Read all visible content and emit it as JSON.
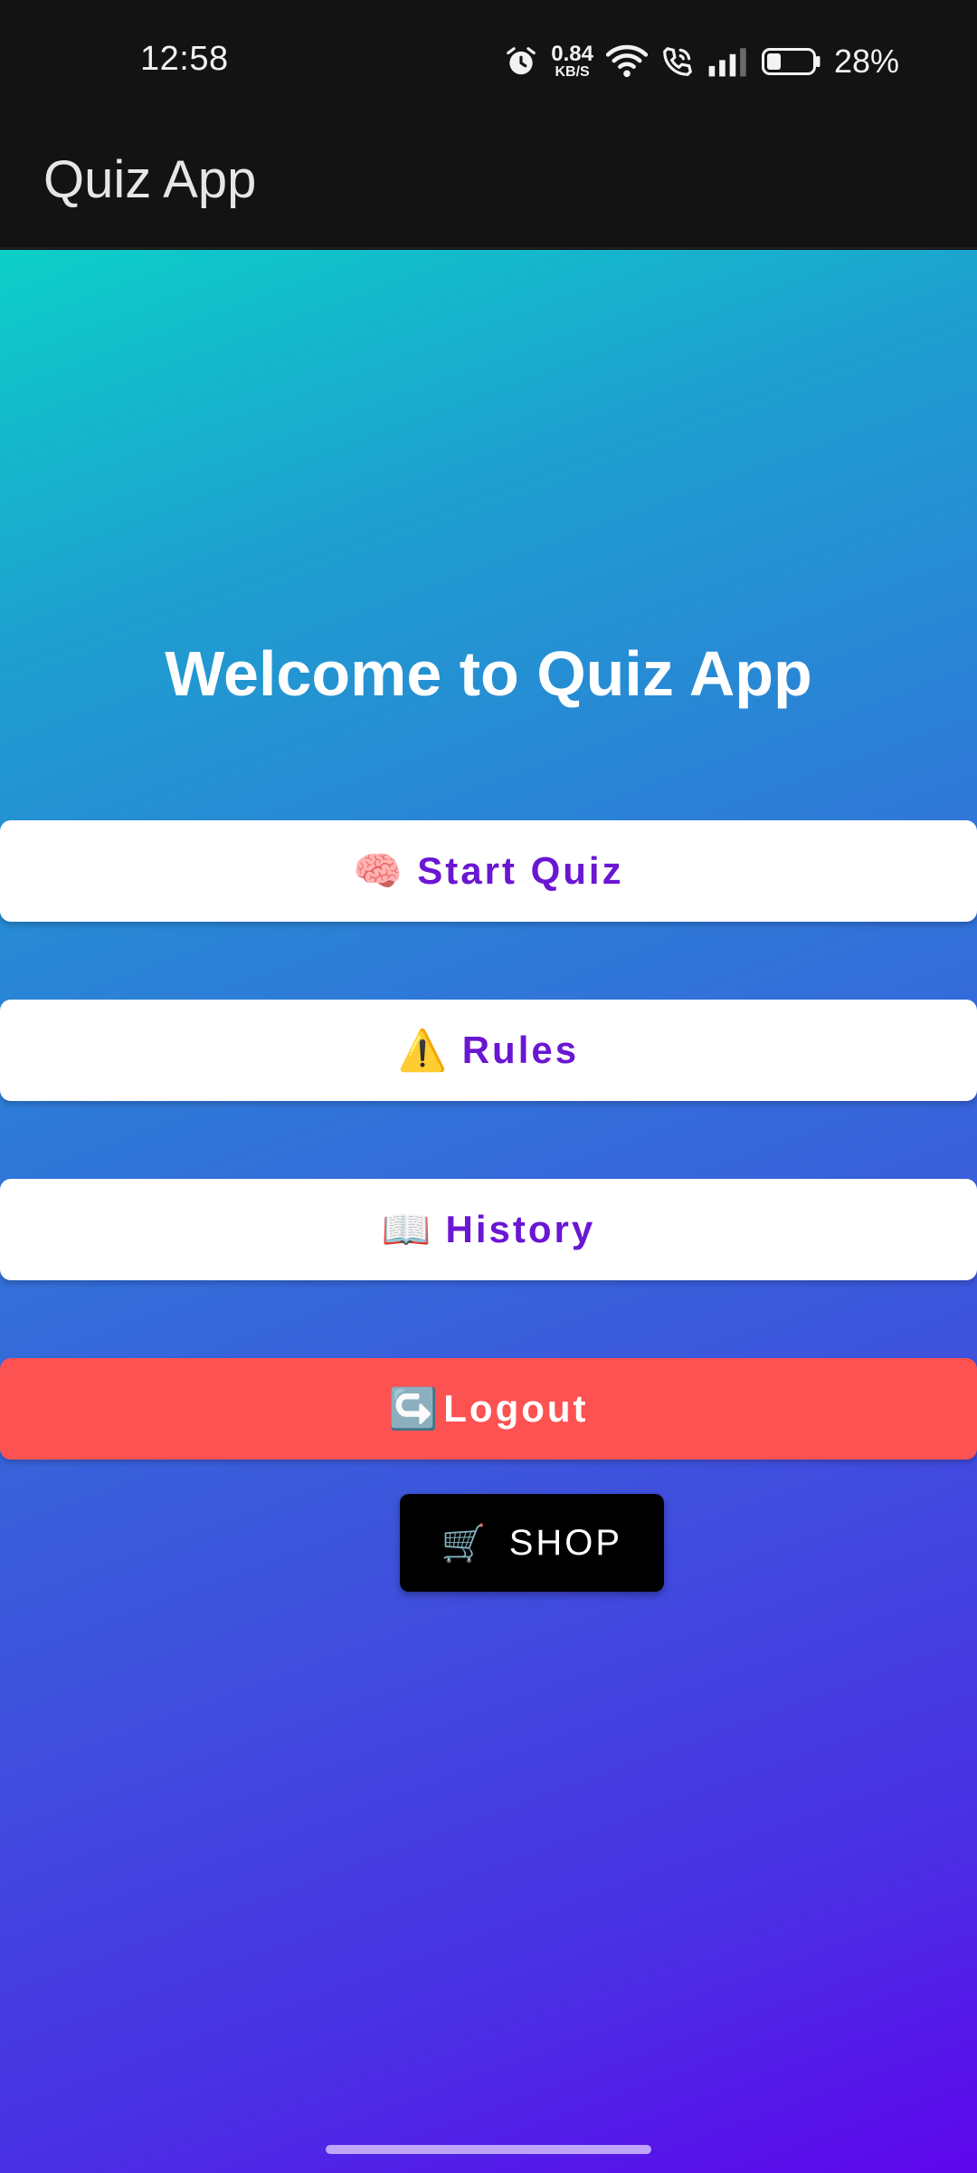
{
  "status_bar": {
    "time": "12:58",
    "net_speed_value": "0.84",
    "net_speed_unit": "KB/S",
    "battery_percent": "28%",
    "icons": [
      "alarm-icon",
      "wifi-icon",
      "wifi-call-icon",
      "signal-icon",
      "battery-icon"
    ]
  },
  "app_bar": {
    "title": "Quiz App"
  },
  "main": {
    "welcome": "Welcome to Quiz App",
    "buttons": {
      "start_quiz": {
        "icon": "🧠",
        "label": "Start Quiz"
      },
      "rules": {
        "icon": "⚠️",
        "label": "Rules"
      },
      "history": {
        "icon": "📖",
        "label": "History"
      },
      "logout": {
        "icon": "↪️",
        "label": "Logout"
      },
      "shop": {
        "icon": "🛒",
        "label": "SHOP"
      }
    }
  },
  "colors": {
    "gradient_start": "#0ccfc8",
    "gradient_end": "#5e06ec",
    "button_text": "#6a16d2",
    "logout_bg": "#fd5252",
    "shop_bg": "#000000",
    "app_bar_bg": "#131313"
  }
}
